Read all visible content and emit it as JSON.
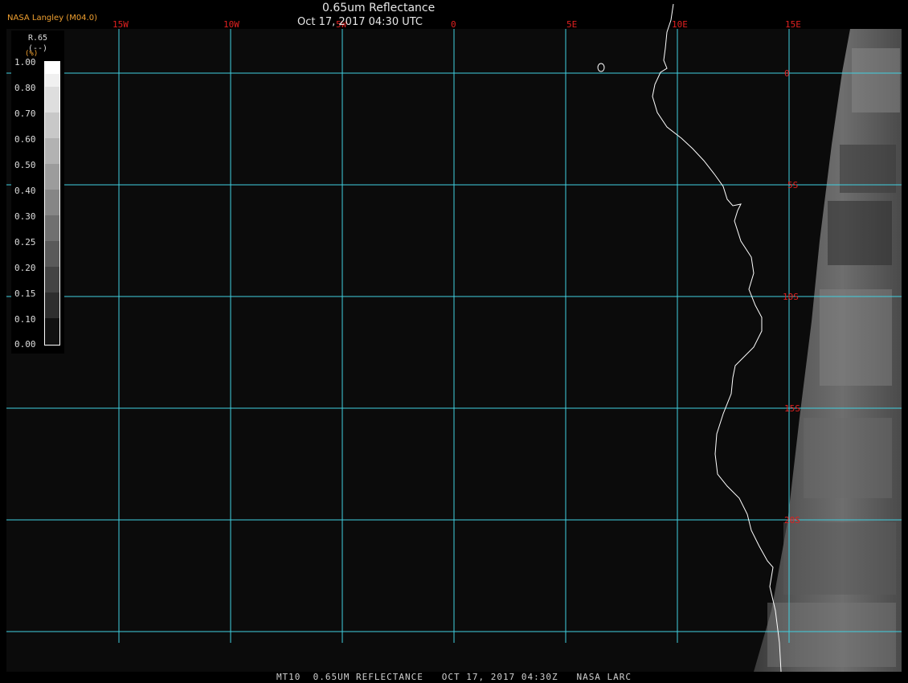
{
  "header": {
    "title": "0.65um Reflectance",
    "datetime": "Oct 17, 2017 04:30 UTC",
    "credit": "NASA Langley (M04.0)"
  },
  "footer": {
    "text": "MT10  0.65UM REFLECTANCE   OCT 17, 2017 04:30Z   NASA LARC"
  },
  "legend": {
    "variable": "R.65",
    "unit": "(--)",
    "unit_mark": "(%)",
    "ticks": [
      "1.00",
      "0.80",
      "0.70",
      "0.60",
      "0.50",
      "0.40",
      "0.30",
      "0.25",
      "0.20",
      "0.15",
      "0.10",
      "0.00"
    ]
  },
  "grid": {
    "lon_labels": [
      "15W",
      "10W",
      "5W",
      "0",
      "5E",
      "10E",
      "15E"
    ],
    "lat_labels": [
      "0",
      "5S",
      "10S",
      "15S",
      "20S"
    ],
    "color": "#40d0e0",
    "label_color": "#e02020"
  },
  "colors": {
    "background": "#0b0b0b",
    "coastline": "#ffffff",
    "cloud_field": "#777777"
  }
}
